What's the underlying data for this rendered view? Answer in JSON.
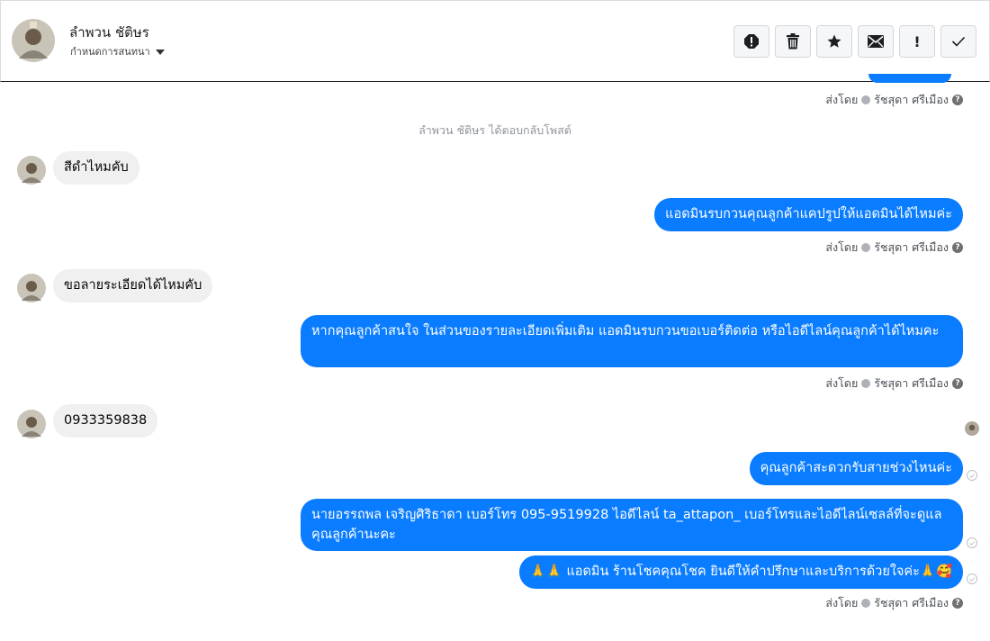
{
  "header": {
    "contact_name": "ลำพวน ชัติษร",
    "subtitle": "กำหนดการสนทนา",
    "toolbar": [
      {
        "name": "report-icon",
        "glyph": "!"
      },
      {
        "name": "trash-icon",
        "glyph": "trash"
      },
      {
        "name": "star-icon",
        "glyph": "★"
      },
      {
        "name": "envelope-icon",
        "glyph": "✉"
      },
      {
        "name": "exclamation-icon",
        "glyph": "!"
      },
      {
        "name": "check-icon",
        "glyph": "✓"
      }
    ]
  },
  "chat": {
    "sent_by_prefix": "ส่งโดย",
    "sender_name": "รัชสุดา ศรีเมือง",
    "event": "ลำพวน ชัติษร ได้ตอบกลับโพสต์",
    "messages": {
      "in1": "สีดำไหมคับ",
      "out1": "แอดมินรบกวนคุณลูกค้าแคปรูปให้แอดมินได้ไหมค่ะ",
      "in2": "ขอลายระเอียดได้ไหมคับ",
      "out2": "หากคุณลูกค้าสนใจ ในส่วนของรายละเอียดเพิ่มเติม แอดมินรบกวนขอเบอร์ติดต่อ หรือไอดีไลน์คุณลูกค้าได้ไหมคะ",
      "in3": "0933359838",
      "out3": "คุณลูกค้าสะดวกรับสายช่วงไหนค่ะ",
      "out4": "นายอรรถพล เจริญศิริธาดา      เบอร์โทร 095-9519928 ไอดีไลน์ ta_attapon_  เบอร์โทรและไอดีไลน์เซลล์ที่จะดูแลคุณลูกค้านะคะ",
      "out5_text": "แอดมิน ร้านโชคคุณโชค ยินดีให้คำปรึกษาและบริการด้วยใจค่ะ",
      "out5_prefix_emoji": "🙏🙏",
      "out5_suffix_emoji": "🙏🥰"
    }
  },
  "colors": {
    "accent": "#0a7cff",
    "incoming": "#f0f0f0",
    "meta": "#4b4f56",
    "event": "#90949c"
  }
}
